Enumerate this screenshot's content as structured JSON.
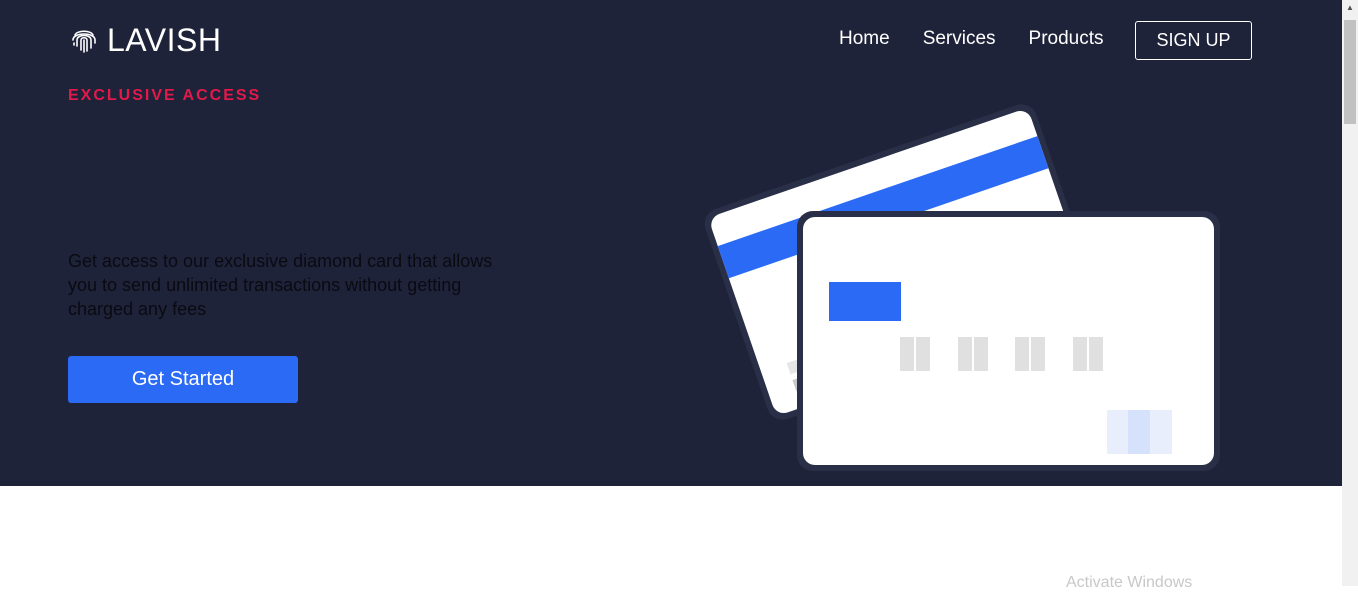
{
  "brand": {
    "name": "LAVISH",
    "icon": "fingerprint-icon"
  },
  "nav": {
    "items": [
      "Home",
      "Services",
      "Products"
    ],
    "signup_label": "SIGN UP"
  },
  "hero": {
    "eyebrow": "EXCLUSIVE ACCESS",
    "description": "Get access to our exclusive diamond card that allows you to send unlimited transactions without getting charged any fees",
    "cta_label": "Get Started"
  },
  "footer": {
    "watermark": "Activate Windows"
  },
  "colors": {
    "hero_background": "#1f233a",
    "accent_red": "#e5184a",
    "primary_blue": "#2a6af5",
    "text_white": "#ffffff"
  }
}
